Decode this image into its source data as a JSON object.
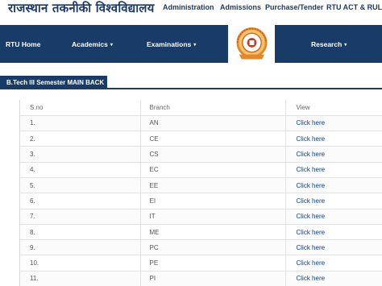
{
  "header": {
    "university_name": "राजस्थान तकनीकी विश्वविद्यालय",
    "top_links": [
      "Administration",
      "Admissions",
      "Purchase/Tender",
      "RTU ACT & RULES"
    ]
  },
  "nav": {
    "items": [
      {
        "label": "RTU Home",
        "has_caret": false
      },
      {
        "label": "Academics",
        "has_caret": true,
        "caret": "▾"
      },
      {
        "label": "Examinations",
        "has_caret": true,
        "caret": "▾"
      },
      {
        "label": "Research",
        "has_caret": true,
        "caret": "▾"
      }
    ],
    "logo_icon": "rtu-emblem-logo"
  },
  "section": {
    "title": "B.Tech III Semester MAIN BACK"
  },
  "table": {
    "headers": [
      "S.no",
      "Branch",
      "View"
    ],
    "rows": [
      {
        "sno": "1.",
        "branch": "AN",
        "view": "Click here"
      },
      {
        "sno": "2.",
        "branch": "CE",
        "view": "Click here"
      },
      {
        "sno": "3.",
        "branch": "CS",
        "view": "Click here"
      },
      {
        "sno": "4.",
        "branch": "EC",
        "view": "Click here"
      },
      {
        "sno": "5.",
        "branch": "EE",
        "view": "Click here"
      },
      {
        "sno": "6.",
        "branch": "EI",
        "view": "Click here"
      },
      {
        "sno": "7.",
        "branch": "IT",
        "view": "Click here"
      },
      {
        "sno": "8.",
        "branch": "ME",
        "view": "Click here"
      },
      {
        "sno": "9.",
        "branch": "PC",
        "view": "Click here"
      },
      {
        "sno": "10.",
        "branch": "PE",
        "view": "Click here"
      },
      {
        "sno": "11.",
        "branch": "PI",
        "view": "Click here"
      }
    ]
  },
  "colors": {
    "navy": "#193b67",
    "link": "#0b3d91",
    "logo_orange": "#e3892b"
  }
}
